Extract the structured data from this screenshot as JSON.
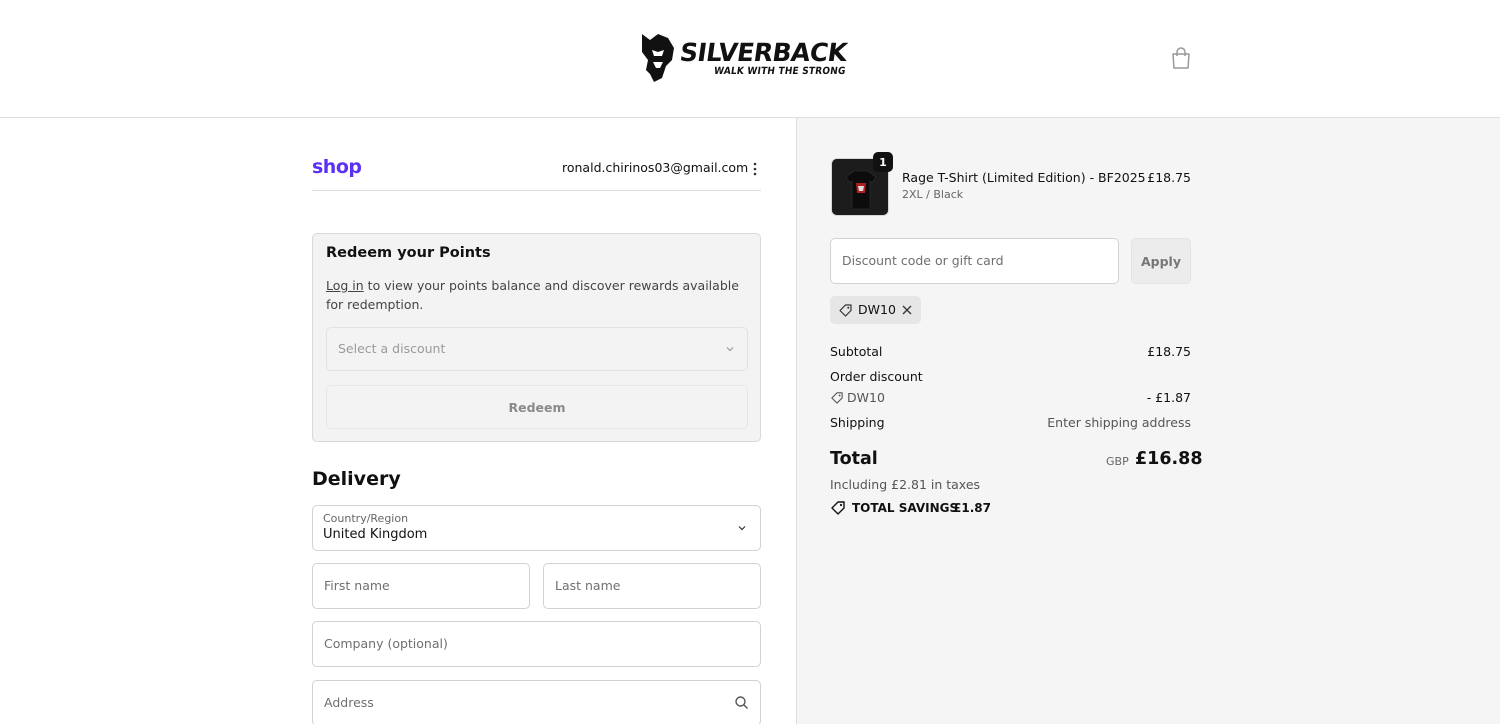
{
  "header": {
    "brand_name": "SILVERBACK",
    "brand_tagline": "WALK WITH THE STRONG",
    "cart_icon": "shopping-bag-icon"
  },
  "account": {
    "shop_logo": "shop",
    "email": "ronald.chirinos03@gmail.com",
    "menu_icon": "more-vertical-icon"
  },
  "points": {
    "title": "Redeem your Points",
    "login_link": "Log in",
    "description": " to view your points balance and discover rewards available for redemption.",
    "select_placeholder": "Select a discount",
    "redeem_label": "Redeem"
  },
  "delivery": {
    "heading": "Delivery",
    "country_label": "Country/Region",
    "country_value": "United Kingdom",
    "first_name_placeholder": "First name",
    "last_name_placeholder": "Last name",
    "company_placeholder": "Company (optional)",
    "address_placeholder": "Address"
  },
  "summary": {
    "product": {
      "name": "Rage T-Shirt (Limited Edition) - BF2025",
      "variant": "2XL / Black",
      "price": "£18.75",
      "quantity": "1"
    },
    "discount_input_placeholder": "Discount code or gift card",
    "apply_label": "Apply",
    "applied_code": "DW10",
    "subtotal_label": "Subtotal",
    "subtotal_value": "£18.75",
    "order_discount_label": "Order discount",
    "discount_code": "DW10",
    "discount_value": "- £1.87",
    "shipping_label": "Shipping",
    "shipping_value": "Enter shipping address",
    "total_label": "Total",
    "total_currency": "GBP",
    "total_value": "£16.88",
    "tax_note": "Including £2.81 in taxes",
    "savings_label": "TOTAL SAVINGS",
    "savings_value": "£1.87"
  },
  "colors": {
    "shop_brand": "#5a31f4",
    "summary_background": "#f5f5f5",
    "text": "#111111"
  }
}
